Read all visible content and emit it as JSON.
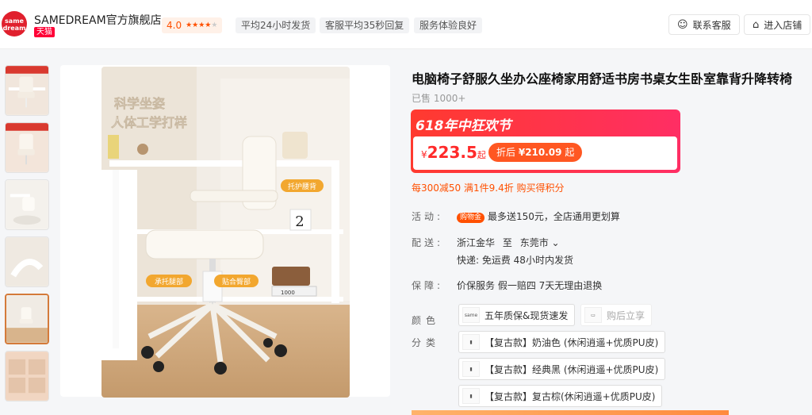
{
  "shop": {
    "logo_text": "same dream",
    "name": "SAMEDREAM官方旗舰店",
    "platform_tag": "天猫",
    "rating": "4.0",
    "badges": [
      "平均24小时发货",
      "客服平均35秒回复",
      "服务体验良好"
    ],
    "contact_label": "联系客服",
    "enter_label": "进入店铺"
  },
  "gallery": {
    "selected_index": 4,
    "main_overlay_title": "科学坐姿",
    "main_overlay_subtitle": "人体工学打样",
    "callouts": [
      "托护腰背",
      "承托腿部",
      "贴合臀部"
    ],
    "box_number": "2",
    "books_label": "1000"
  },
  "product": {
    "title": "电脑椅子舒服久坐办公座椅家用舒适书房书桌女生卧室靠背升降转椅",
    "sold": "已售 1000+",
    "promo_title": "618年中狂欢节",
    "price_currency": "¥",
    "price": "223.5",
    "price_suffix": "起",
    "discount_prefix": "折后",
    "discount_price": "¥210.09",
    "discount_suffix": "起",
    "coupon": "每300减50 满1件9.4折 购买得积分"
  },
  "details": {
    "activity_label": "活动:",
    "activity_tag": "购物金",
    "activity_text": "最多送150元，全店通用更划算",
    "delivery_label": "配送:",
    "delivery_from": "浙江金华",
    "delivery_to_word": "至",
    "delivery_to": "东莞市",
    "delivery_line2": "快递: 免运费 48小时内发货",
    "guarantee_label": "保障:",
    "guarantee_text": "价保服务 假一赔四 7天无理由退换",
    "color_label": "颜色分类",
    "color_options": [
      {
        "label": "五年质保&现货速发",
        "disabled": false
      },
      {
        "label": "购后立享",
        "disabled": true
      },
      {
        "label": "【复古款】奶油色 (休闲逍遥+优质PU皮)",
        "disabled": false
      },
      {
        "label": "【复古款】经典黑 (休闲逍遥+优质PU皮)",
        "disabled": false
      },
      {
        "label": "【复古款】复古棕(休闲逍遥+优质PU皮)",
        "disabled": false
      }
    ]
  },
  "colors": {
    "accent": "#ff5000",
    "brand_red": "#e0202d",
    "promo_red": "#ff2e64"
  }
}
